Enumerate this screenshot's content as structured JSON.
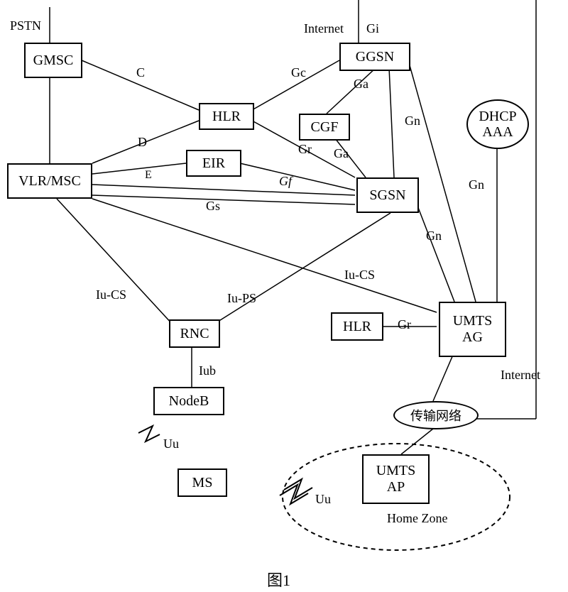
{
  "nodes": {
    "gmsc": "GMSC",
    "ggsn": "GGSN",
    "hlr1": "HLR",
    "cgf": "CGF",
    "eir": "EIR",
    "vlr_msc": "VLR/MSC",
    "sgsn": "SGSN",
    "rnc": "RNC",
    "hlr2": "HLR",
    "umts_ag": "UMTS\nAG",
    "nodeb": "NodeB",
    "ms": "MS",
    "umts_ap": "UMTS\nAP",
    "dhcp_aaa": "DHCP\nAAA",
    "transport": "传输网络",
    "home_zone": "Home Zone"
  },
  "labels": {
    "pstn": "PSTN",
    "internet1": "Internet",
    "gi": "Gi",
    "c": "C",
    "gc": "Gc",
    "ga1": "Ga",
    "d": "D",
    "gn1": "Gn",
    "e": "E",
    "gr1": "Gr",
    "ga2": "Ga",
    "gf": "Gf",
    "gn2": "Gn",
    "gs": "Gs",
    "gn3": "Gn",
    "iu_cs1": "Iu-CS",
    "iu_cs2": "Iu-CS",
    "iu_ps": "Iu-PS",
    "gr2": "Gr",
    "iub": "Iub",
    "internet2": "Internet",
    "uu1": "Uu",
    "uu2": "Uu"
  },
  "figure": "图1"
}
